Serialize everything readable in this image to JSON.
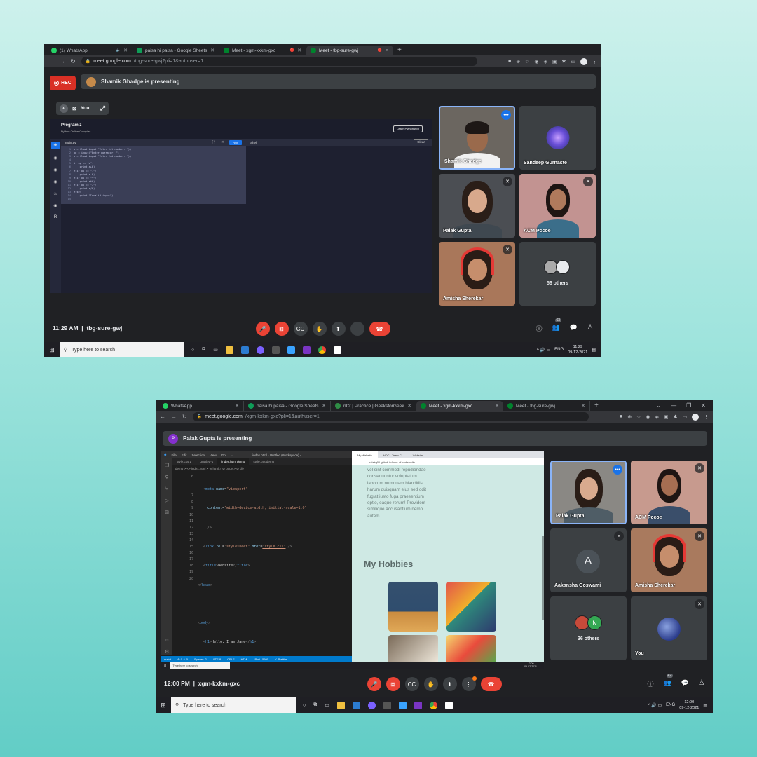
{
  "s1": {
    "tabs": [
      {
        "label": "(1) WhatsApp",
        "color": "#25d366",
        "extra": "🔈"
      },
      {
        "label": "paisa hi paisa - Google Sheets",
        "color": "#0f9d58",
        "extra": ""
      },
      {
        "label": "Meet - xgm-kxkm-gxc",
        "color": "#00832d",
        "extra": "🔴"
      },
      {
        "label": "Meet - tbg-sure-gwj",
        "color": "#00832d",
        "extra": "🔴",
        "active": true
      }
    ],
    "url_host": "meet.google.com",
    "url_path": "/tbg-sure-gwj?pli=1&authuser=1",
    "rec": "REC",
    "presenting": "Shamik Ghadge is presenting",
    "you_label": "You",
    "programiz": {
      "brand": "Programiz",
      "sub": "Python Online Compiler",
      "cta": "Learn Python App",
      "file": "main.py",
      "run": "Run",
      "shell": "Shell",
      "clear": "Clear"
    },
    "code_lines": [
      "a = float(input(\"Enter 1st number: \"))",
      "op = input(\"Enter operator: \")",
      "b = float(input(\"Enter 2nd number: \"))",
      "",
      "if op == \"+\":",
      "    print(a+b)",
      "elif op == \"-\":",
      "    print(a-b)",
      "elif op == \"*\":",
      "    print(a*b)",
      "elif op == \"/\":",
      "    print(a/b)",
      "else:",
      "    print(\"Invalid input\")",
      ""
    ],
    "participants": [
      {
        "name": "Shamik Ghadge"
      },
      {
        "name": "Sandeep Gurnaste"
      },
      {
        "name": "Palak Gupta"
      },
      {
        "name": "ACM Pccoe"
      },
      {
        "name": "Amisha Sherekar"
      },
      {
        "name": "56 others"
      }
    ],
    "time": "11:29 AM",
    "code": "tbg-sure-gwj",
    "people_count": "63",
    "search": "Type here to search",
    "tray_lang": "ENG",
    "tray_time": "11:29",
    "tray_date": "09-12-2021"
  },
  "s2": {
    "tabs": [
      {
        "label": "WhatsApp",
        "color": "#25d366"
      },
      {
        "label": "paisa hi paisa - Google Sheets",
        "color": "#0f9d58"
      },
      {
        "label": "nCr | Practice | GeeksforGeeks",
        "color": "#2f8d46"
      },
      {
        "label": "Meet - xgm-kxkm-gxc",
        "color": "#00832d",
        "active": true
      },
      {
        "label": "Meet - tbg-sure-gwj",
        "color": "#00832d"
      }
    ],
    "url_host": "meet.google.com",
    "url_path": "/xgm-kxkm-gxc?pli=1&authuser=1",
    "presenter_initial": "P",
    "presenting": "Palak Gupta is presenting",
    "vscode": {
      "menu": [
        "File",
        "Edit",
        "Selection",
        "View",
        "Go",
        "···"
      ],
      "title": "index.html - Untitled (Workspace) - ...",
      "tabs": [
        "style.css 1",
        "Untitled-1",
        "index.html demo",
        "style.css demo"
      ],
      "breadcrumb": "demo > <> index.html > ⊘ html > ⊘ body > ⊘ div",
      "line_numbers": [
        "6",
        "",
        "",
        "7",
        "8",
        "9",
        "10",
        "11",
        "12",
        "13",
        "14",
        "15",
        "16",
        "17",
        "18",
        "19",
        "20"
      ],
      "status": [
        "main*",
        "⊗ 0 ⚠ 0",
        "Spaces: 2",
        "UTF-8",
        "CRLF",
        "HTML",
        "Port : 5500",
        "✓ Prettier"
      ]
    },
    "browser": {
      "tabs": [
        "My Website",
        "HDC - Team C",
        "Website"
      ],
      "url": "palakg01.github.io/hour-of-code/indiv...",
      "lorem": [
        "vel sint commodi repudiandae",
        "consequuntur voluptatum",
        "laborum numquam blanditiis",
        "harum quisquam eius sed odit",
        "fugiat iusto fuga praesentium",
        "optio, eaque rerum! Provident",
        "similique accusantium nemo",
        "autem."
      ],
      "heading": "My Hobbies"
    },
    "participants": [
      {
        "name": "Palak Gupta"
      },
      {
        "name": "ACM Pccoe"
      },
      {
        "name": "Aakansha Goswami",
        "initial": "A"
      },
      {
        "name": "Amisha Sherekar"
      },
      {
        "name": "36 others",
        "initial": "N"
      },
      {
        "name": "You"
      }
    ],
    "time": "12:00 PM",
    "code": "xgm-kxkm-gxc",
    "people_count": "42",
    "search": "Type here to search",
    "tray_lang": "ENG",
    "tray_time": "12:00",
    "tray_date": "09-12-2021",
    "inner_tray_time": "12:00",
    "inner_tray_date": "09-12-2021"
  }
}
